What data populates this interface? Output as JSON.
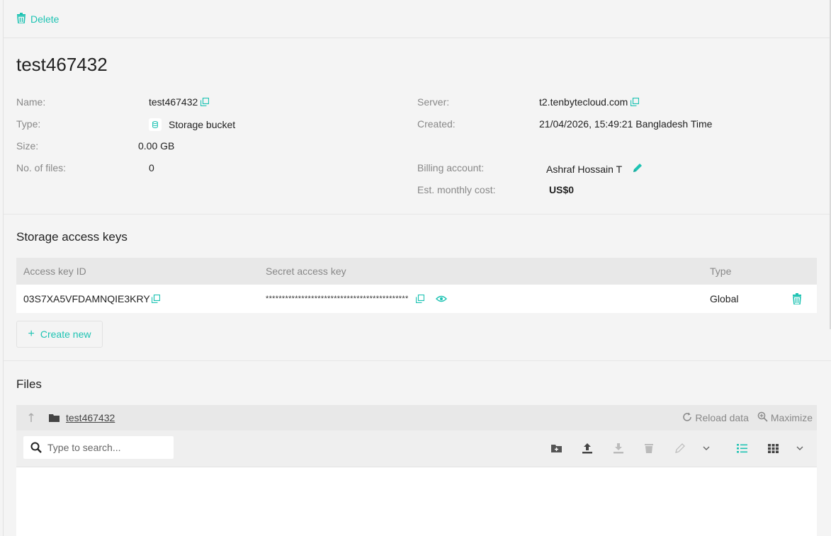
{
  "toolbar": {
    "delete_label": "Delete"
  },
  "bucket": {
    "title": "test467432",
    "props_left": [
      {
        "label": "Name:",
        "value": "test467432"
      },
      {
        "label": "Type:",
        "value": "Storage bucket"
      },
      {
        "label": "Size:",
        "value": "0.00 GB"
      },
      {
        "label": "No. of files:",
        "value": "0"
      }
    ],
    "props_right": [
      {
        "label": "Server:",
        "value": "t2.tenbytecloud.com"
      },
      {
        "label": "Created:",
        "value": "21/04/2026, 15:49:21 Bangladesh Time"
      },
      {
        "label": "Billing account:",
        "value": "Ashraf Hossain T"
      },
      {
        "label": "Est. monthly cost:",
        "value": "US$0"
      }
    ]
  },
  "keys": {
    "section_title": "Storage access keys",
    "columns": [
      "Access key ID",
      "Secret access key",
      "Type"
    ],
    "rows": [
      {
        "access_key_id": "03S7XA5VFDAMNQIE3KRY",
        "secret": "********************************************",
        "type": "Global"
      }
    ],
    "create_label": "Create new"
  },
  "files": {
    "section_title": "Files",
    "folder": "test467432",
    "reload_label": "Reload data",
    "maximize_label": "Maximize",
    "search_placeholder": "Type to search..."
  },
  "colors": {
    "accent": "#1ec3b3",
    "muted": "#888888"
  }
}
